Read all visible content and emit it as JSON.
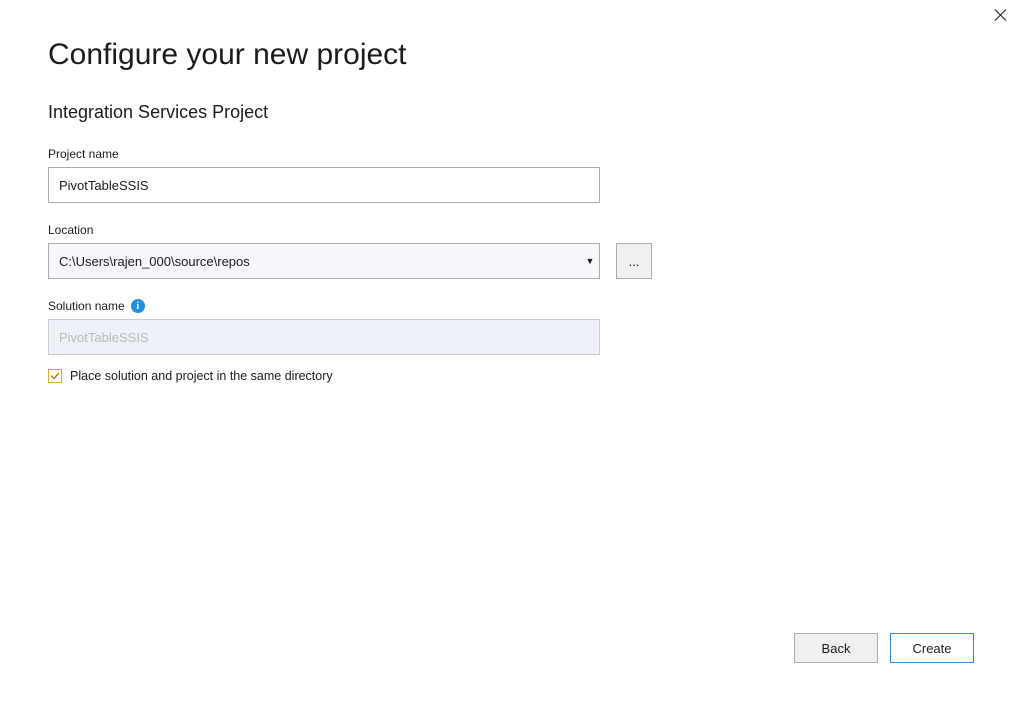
{
  "header": {
    "title": "Configure your new project",
    "subtitle": "Integration Services Project"
  },
  "project_name": {
    "label": "Project name",
    "value": "PivotTableSSIS"
  },
  "location": {
    "label": "Location",
    "value": "C:\\Users\\rajen_000\\source\\repos",
    "browse_label": "..."
  },
  "solution_name": {
    "label": "Solution name",
    "value": "PivotTableSSIS"
  },
  "same_dir_checkbox": {
    "checked": true,
    "label": "Place solution and project in the same directory"
  },
  "buttons": {
    "back": "Back",
    "create": "Create"
  }
}
